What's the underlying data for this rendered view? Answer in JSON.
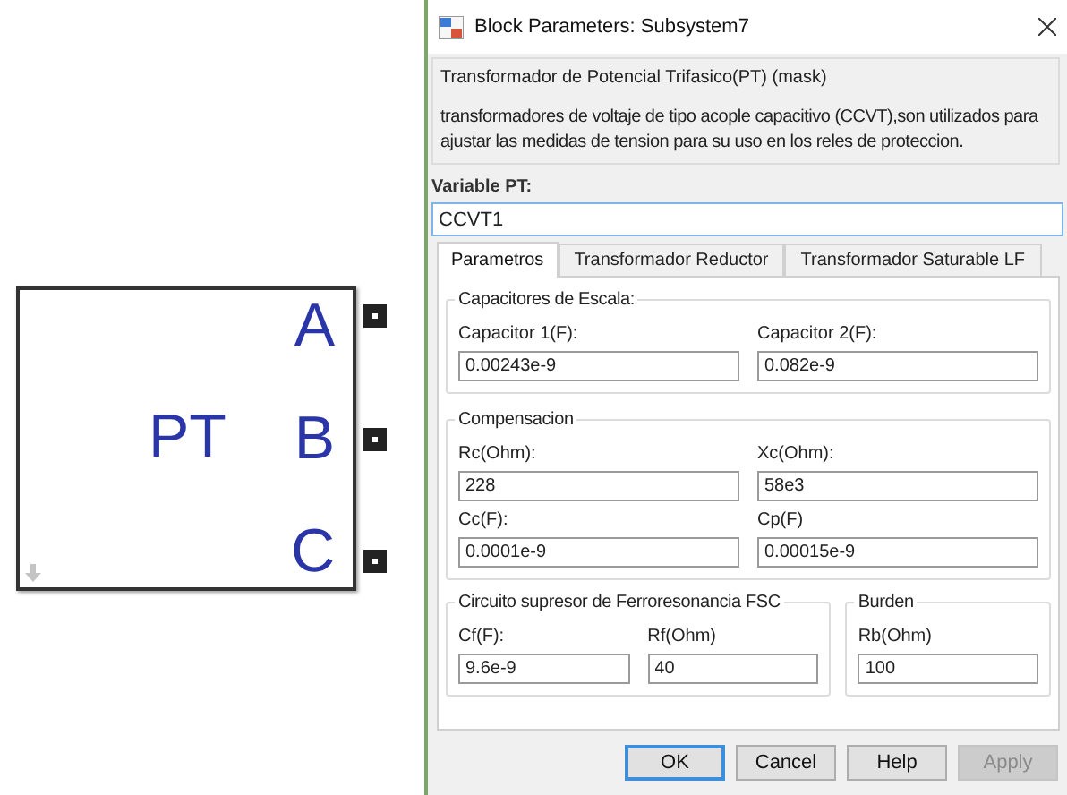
{
  "block": {
    "label": "PT",
    "ports": [
      "A",
      "B",
      "C"
    ]
  },
  "dialog": {
    "title": "Block Parameters: Subsystem7",
    "mask_title": "Transformador de Potencial Trifasico(PT) (mask)",
    "description": "transformadores de voltaje de tipo acople capacitivo (CCVT),son utilizados para ajustar las medidas de tension para su uso en los reles de proteccion.",
    "variable": {
      "label": "Variable PT:",
      "value": "CCVT1"
    },
    "tabs": [
      {
        "label": "Parametros",
        "selected": true
      },
      {
        "label": "Transformador Reductor",
        "selected": false
      },
      {
        "label": "Transformador Saturable LF",
        "selected": false
      }
    ],
    "groups": [
      {
        "title": "Capacitores de Escala:",
        "fields": [
          {
            "label": "Capacitor 1(F):",
            "value": "0.00243e-9"
          },
          {
            "label": "Capacitor 2(F):",
            "value": "0.082e-9"
          }
        ]
      },
      {
        "title": "Compensacion",
        "fields": [
          {
            "label": "Rc(Ohm):",
            "value": "228"
          },
          {
            "label": "Xc(Ohm):",
            "value": "58e3"
          },
          {
            "label": "Cc(F):",
            "value": "0.0001e-9"
          },
          {
            "label": "Cp(F)",
            "value": "0.00015e-9"
          }
        ]
      }
    ],
    "bottom_groups": [
      {
        "title": "Circuito supresor de Ferroresonancia FSC",
        "fields": [
          {
            "label": "Cf(F):",
            "value": "9.6e-9"
          },
          {
            "label": "Rf(Ohm)",
            "value": "40"
          }
        ]
      },
      {
        "title": "Burden",
        "fields": [
          {
            "label": "Rb(Ohm)",
            "value": "100"
          }
        ]
      }
    ],
    "buttons": [
      {
        "label": "OK",
        "default": true,
        "disabled": false
      },
      {
        "label": "Cancel",
        "default": false,
        "disabled": false
      },
      {
        "label": "Help",
        "default": false,
        "disabled": false
      },
      {
        "label": "Apply",
        "default": false,
        "disabled": true
      }
    ]
  }
}
